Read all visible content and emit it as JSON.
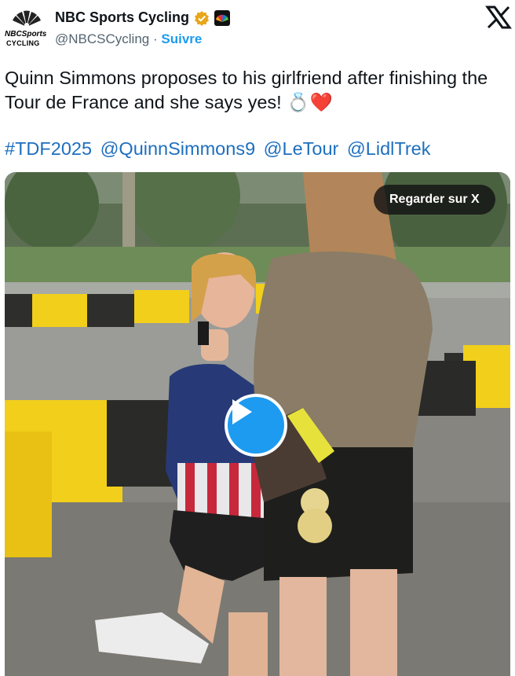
{
  "author": {
    "display_name": "NBC Sports Cycling",
    "handle": "@NBCSCycling",
    "separator": "·",
    "follow_label": "Suivre",
    "avatar_text": {
      "brand": "NBCSports",
      "sub": "CYCLING"
    },
    "verified_icon": "verified-badge-icon",
    "affiliate_icon": "nbc-peacock-icon"
  },
  "platform_icon": "x-logo-icon",
  "tweet": {
    "text": "Quinn Simmons proposes to his girlfriend after finishing the Tour de France and she says yes! 💍❤️",
    "hashtags": [
      "#TDF2025",
      "@QuinnSimmons9",
      "@LeTour",
      "@LidlTrek"
    ]
  },
  "media": {
    "watch_label": "Regarder sur X",
    "play_icon": "play-icon"
  },
  "colors": {
    "link": "#1d6fbf",
    "follow": "#1d9bf0",
    "play_button": "#1d9bf0",
    "verified": "#e8a619"
  }
}
